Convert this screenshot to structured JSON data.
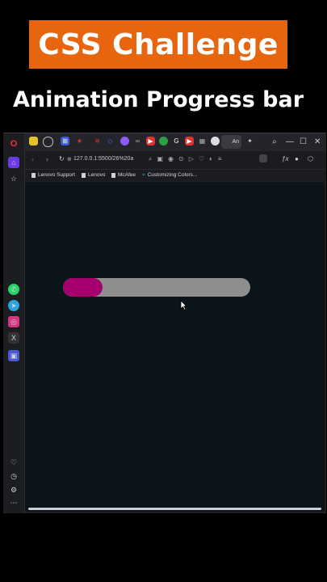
{
  "header": {
    "title": "CSS Challenge",
    "subtitle": "Animation Progress bar"
  },
  "browser": {
    "url": "127.0.0.1:5500/26%20a",
    "active_tab_label": "An",
    "bookmarks": [
      "Lenovo Support",
      "Lenovo",
      "McAfee",
      "Customizing Colors..."
    ]
  },
  "progress": {
    "value": 0.21,
    "fill_color": "#a5006e",
    "track_color": "#8e8e8e"
  },
  "colors": {
    "banner": "#e8650f",
    "page_bg": "#0b1419"
  }
}
